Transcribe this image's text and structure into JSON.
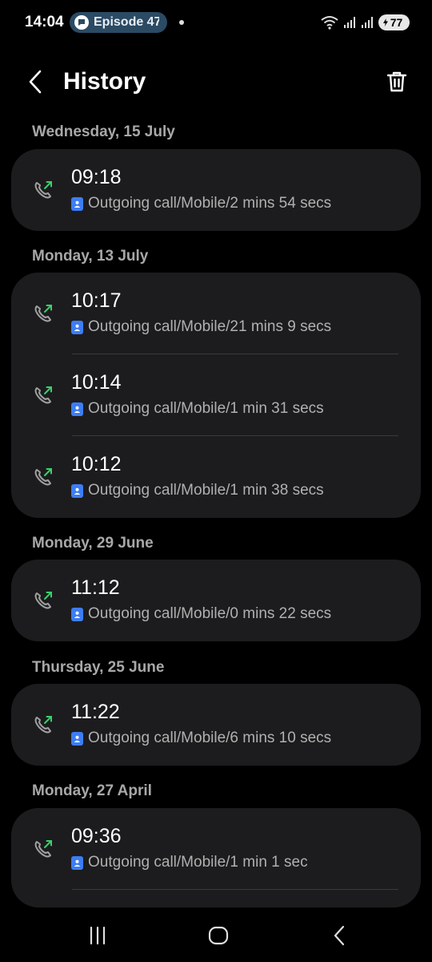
{
  "status_bar": {
    "time": "14:04",
    "notification_pill": "Episode 47",
    "battery_level": "77"
  },
  "header": {
    "back_icon": "chevron-left-icon",
    "title": "History",
    "delete_icon": "trash-icon"
  },
  "colors": {
    "background": "#000000",
    "card": "#1c1c1e",
    "outgoing_arrow": "#3ccf6b",
    "contact_badge": "#3d7df4"
  },
  "groups": [
    {
      "date": "Wednesday, 15 July",
      "entries": [
        {
          "time": "09:18",
          "detail": "Outgoing call/Mobile/2 mins 54 secs"
        }
      ]
    },
    {
      "date": "Monday, 13 July",
      "entries": [
        {
          "time": "10:17",
          "detail": "Outgoing call/Mobile/21 mins 9 secs"
        },
        {
          "time": "10:14",
          "detail": "Outgoing call/Mobile/1 min 31 secs"
        },
        {
          "time": "10:12",
          "detail": "Outgoing call/Mobile/1 min 38 secs"
        }
      ]
    },
    {
      "date": "Monday, 29 June",
      "entries": [
        {
          "time": "11:12",
          "detail": "Outgoing call/Mobile/0 mins 22 secs"
        }
      ]
    },
    {
      "date": "Thursday, 25 June",
      "entries": [
        {
          "time": "11:22",
          "detail": "Outgoing call/Mobile/6 mins 10 secs"
        }
      ]
    },
    {
      "date": "Monday, 27 April",
      "entries": [
        {
          "time": "09:36",
          "detail": "Outgoing call/Mobile/1 min 1 sec"
        }
      ]
    }
  ],
  "nav_bar": {
    "recents_icon": "recents-icon",
    "home_icon": "home-icon",
    "back_icon": "back-icon"
  }
}
